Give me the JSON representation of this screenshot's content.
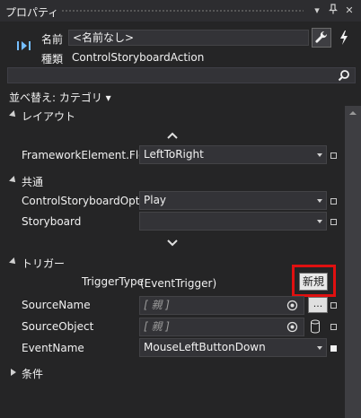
{
  "titlebar": {
    "title": "プロパティ",
    "icons": [
      "dropdown-icon",
      "pin-icon",
      "close-icon"
    ]
  },
  "header": {
    "name_label": "名前",
    "name_value": "<名前なし>",
    "type_label": "種類",
    "type_value": "ControlStoryboardAction",
    "buttons": [
      "wrench-icon",
      "bolt-icon"
    ]
  },
  "search": {
    "placeholder": ""
  },
  "sort_label": "並べ替え: カテゴリ ▾",
  "sections": {
    "layout": "レイアウト",
    "common": "共通",
    "trigger": "トリガー",
    "condition": "条件"
  },
  "layout_props": [
    {
      "label": "FrameworkElement.Flo...",
      "value": "LeftToRight"
    }
  ],
  "common_props": [
    {
      "label": "ControlStoryboardOpt...",
      "value": "Play"
    },
    {
      "label": "Storyboard",
      "value": ""
    }
  ],
  "trigger": {
    "trigger_type_label": "TriggerType",
    "trigger_type_value": "(EventTrigger)",
    "new_button": "新規",
    "source_name_label": "SourceName",
    "source_name_value": "[ 親 ]",
    "source_object_label": "SourceObject",
    "source_object_value": "[ 親 ]",
    "dots_button": "...",
    "event_name_label": "EventName",
    "event_name_value": "MouseLeftButtonDown"
  },
  "colors": {
    "background": "#252526",
    "highlight": "#e01010"
  }
}
